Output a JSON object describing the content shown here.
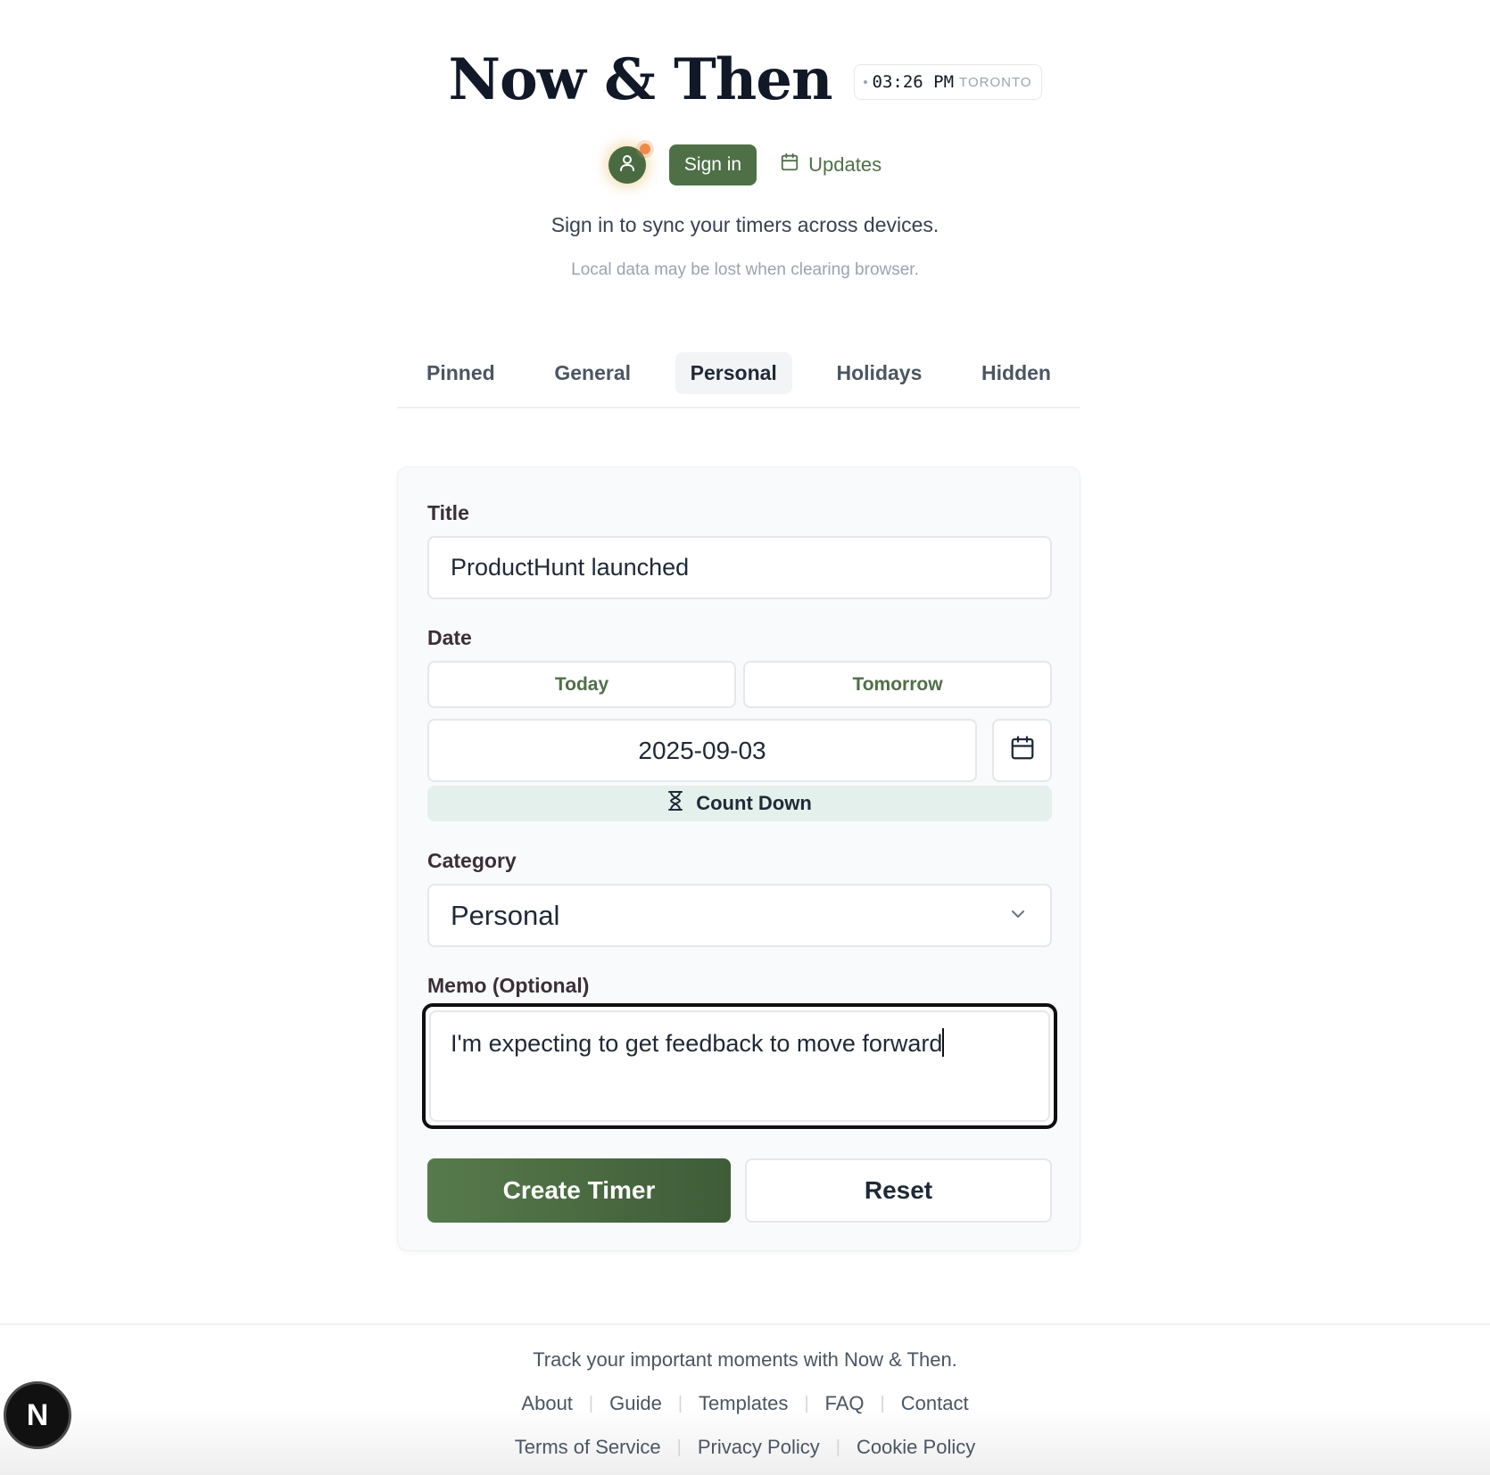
{
  "header": {
    "title": "Now & Then",
    "clock_time": "03:26 PM",
    "clock_city": "TORONTO",
    "signin_label": "Sign in",
    "updates_label": "Updates",
    "sync_message": "Sign in to sync your timers across devices.",
    "local_warning": "Local data may be lost when clearing browser."
  },
  "tabs": [
    {
      "label": "Pinned"
    },
    {
      "label": "General"
    },
    {
      "label": "Personal"
    },
    {
      "label": "Holidays"
    },
    {
      "label": "Hidden"
    }
  ],
  "active_tab": "Personal",
  "form": {
    "title_label": "Title",
    "title_value": "ProductHunt launched",
    "date_label": "Date",
    "today_label": "Today",
    "tomorrow_label": "Tomorrow",
    "date_value": "2025-09-03",
    "countdown_label": "Count Down",
    "category_label": "Category",
    "category_value": "Personal",
    "memo_label": "Memo (Optional)",
    "memo_value": "I'm expecting to get feedback to move forward",
    "create_label": "Create Timer",
    "reset_label": "Reset"
  },
  "footer": {
    "tagline": "Track your important moments with Now & Then.",
    "links_row1": [
      "About",
      "Guide",
      "Templates",
      "FAQ",
      "Contact"
    ],
    "links_row2": [
      "Terms of Service",
      "Privacy Policy",
      "Cookie Policy"
    ]
  },
  "badge_letter": "N",
  "colors": {
    "accent": "#4f7047",
    "accent_dark": "#3f5c38",
    "notification": "#f08a4b",
    "countdown_bg": "#e4f0ec"
  },
  "icons": {
    "avatar": "user-icon",
    "updates": "calendar-icon",
    "date_picker": "calendar-icon",
    "countdown": "hourglass-icon",
    "select": "chevron-down-icon"
  }
}
